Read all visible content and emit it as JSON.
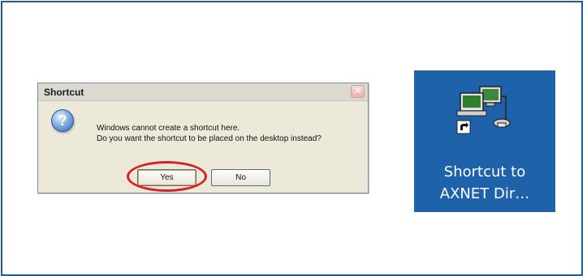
{
  "dialog": {
    "title": "Shortcut",
    "close_glyph": "✕",
    "icon": "help-question-icon",
    "message_line1": "Windows cannot create a shortcut here.",
    "message_line2": "Do you want the shortcut to be placed on the desktop instead?",
    "yes_label": "Yes",
    "no_label": "No"
  },
  "annotation": {
    "highlight_color": "#d81e28",
    "target": "yes-button"
  },
  "desktop_icon": {
    "icon": "network-computers-shortcut-icon",
    "label_line1": "Shortcut to",
    "label_line2": "AXNET Dir…",
    "background": "#1e62aa"
  },
  "colors": {
    "frame_border": "#1d5d9a"
  }
}
